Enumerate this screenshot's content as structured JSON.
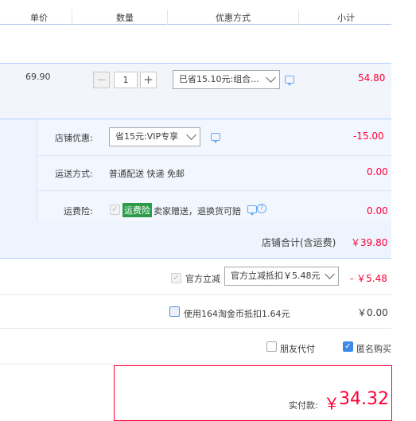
{
  "header": {
    "unit_price": "单价",
    "quantity": "数量",
    "discount_method": "优惠方式",
    "subtotal": "小计"
  },
  "item": {
    "unit_price": "69.90",
    "quantity": "1",
    "minus": "−",
    "plus": "+",
    "discount_select": "已省15.10元:组合...",
    "subtotal": "54.80"
  },
  "shop": {
    "promo_label": "店铺优惠:",
    "promo_select": "省15元:VIP专享",
    "promo_amount": "-15.00",
    "shipping_label": "运送方式:",
    "shipping_value": "普通配送 快递 免邮",
    "shipping_amount": "0.00",
    "insurance_label": "运费险:",
    "insurance_tag": "运费险",
    "insurance_desc": "卖家赠送，退换货可赔",
    "insurance_amount": "0.00",
    "help_icon": "?",
    "total_label": "店铺合计(含运费)",
    "total_amount": "￥39.80"
  },
  "official": {
    "label": "官方立减",
    "select": "官方立减抵扣￥5.48元",
    "amount": "- ￥5.48"
  },
  "coins": {
    "label": "使用164淘金币抵扣1.64元",
    "amount": "￥0.00"
  },
  "options": {
    "friend_pay": "朋友代付",
    "anonymous": "匿名购买"
  },
  "payment": {
    "label": "实付款:",
    "currency": "￥",
    "amount": "34.32"
  },
  "colors": {
    "accent_red": "#ff0036",
    "accent_blue": "#3d8ae6",
    "row_bg": "#f2f6fc",
    "insurance_tag_bg": "#2c9c4b"
  },
  "icons": {
    "check": "✓"
  }
}
